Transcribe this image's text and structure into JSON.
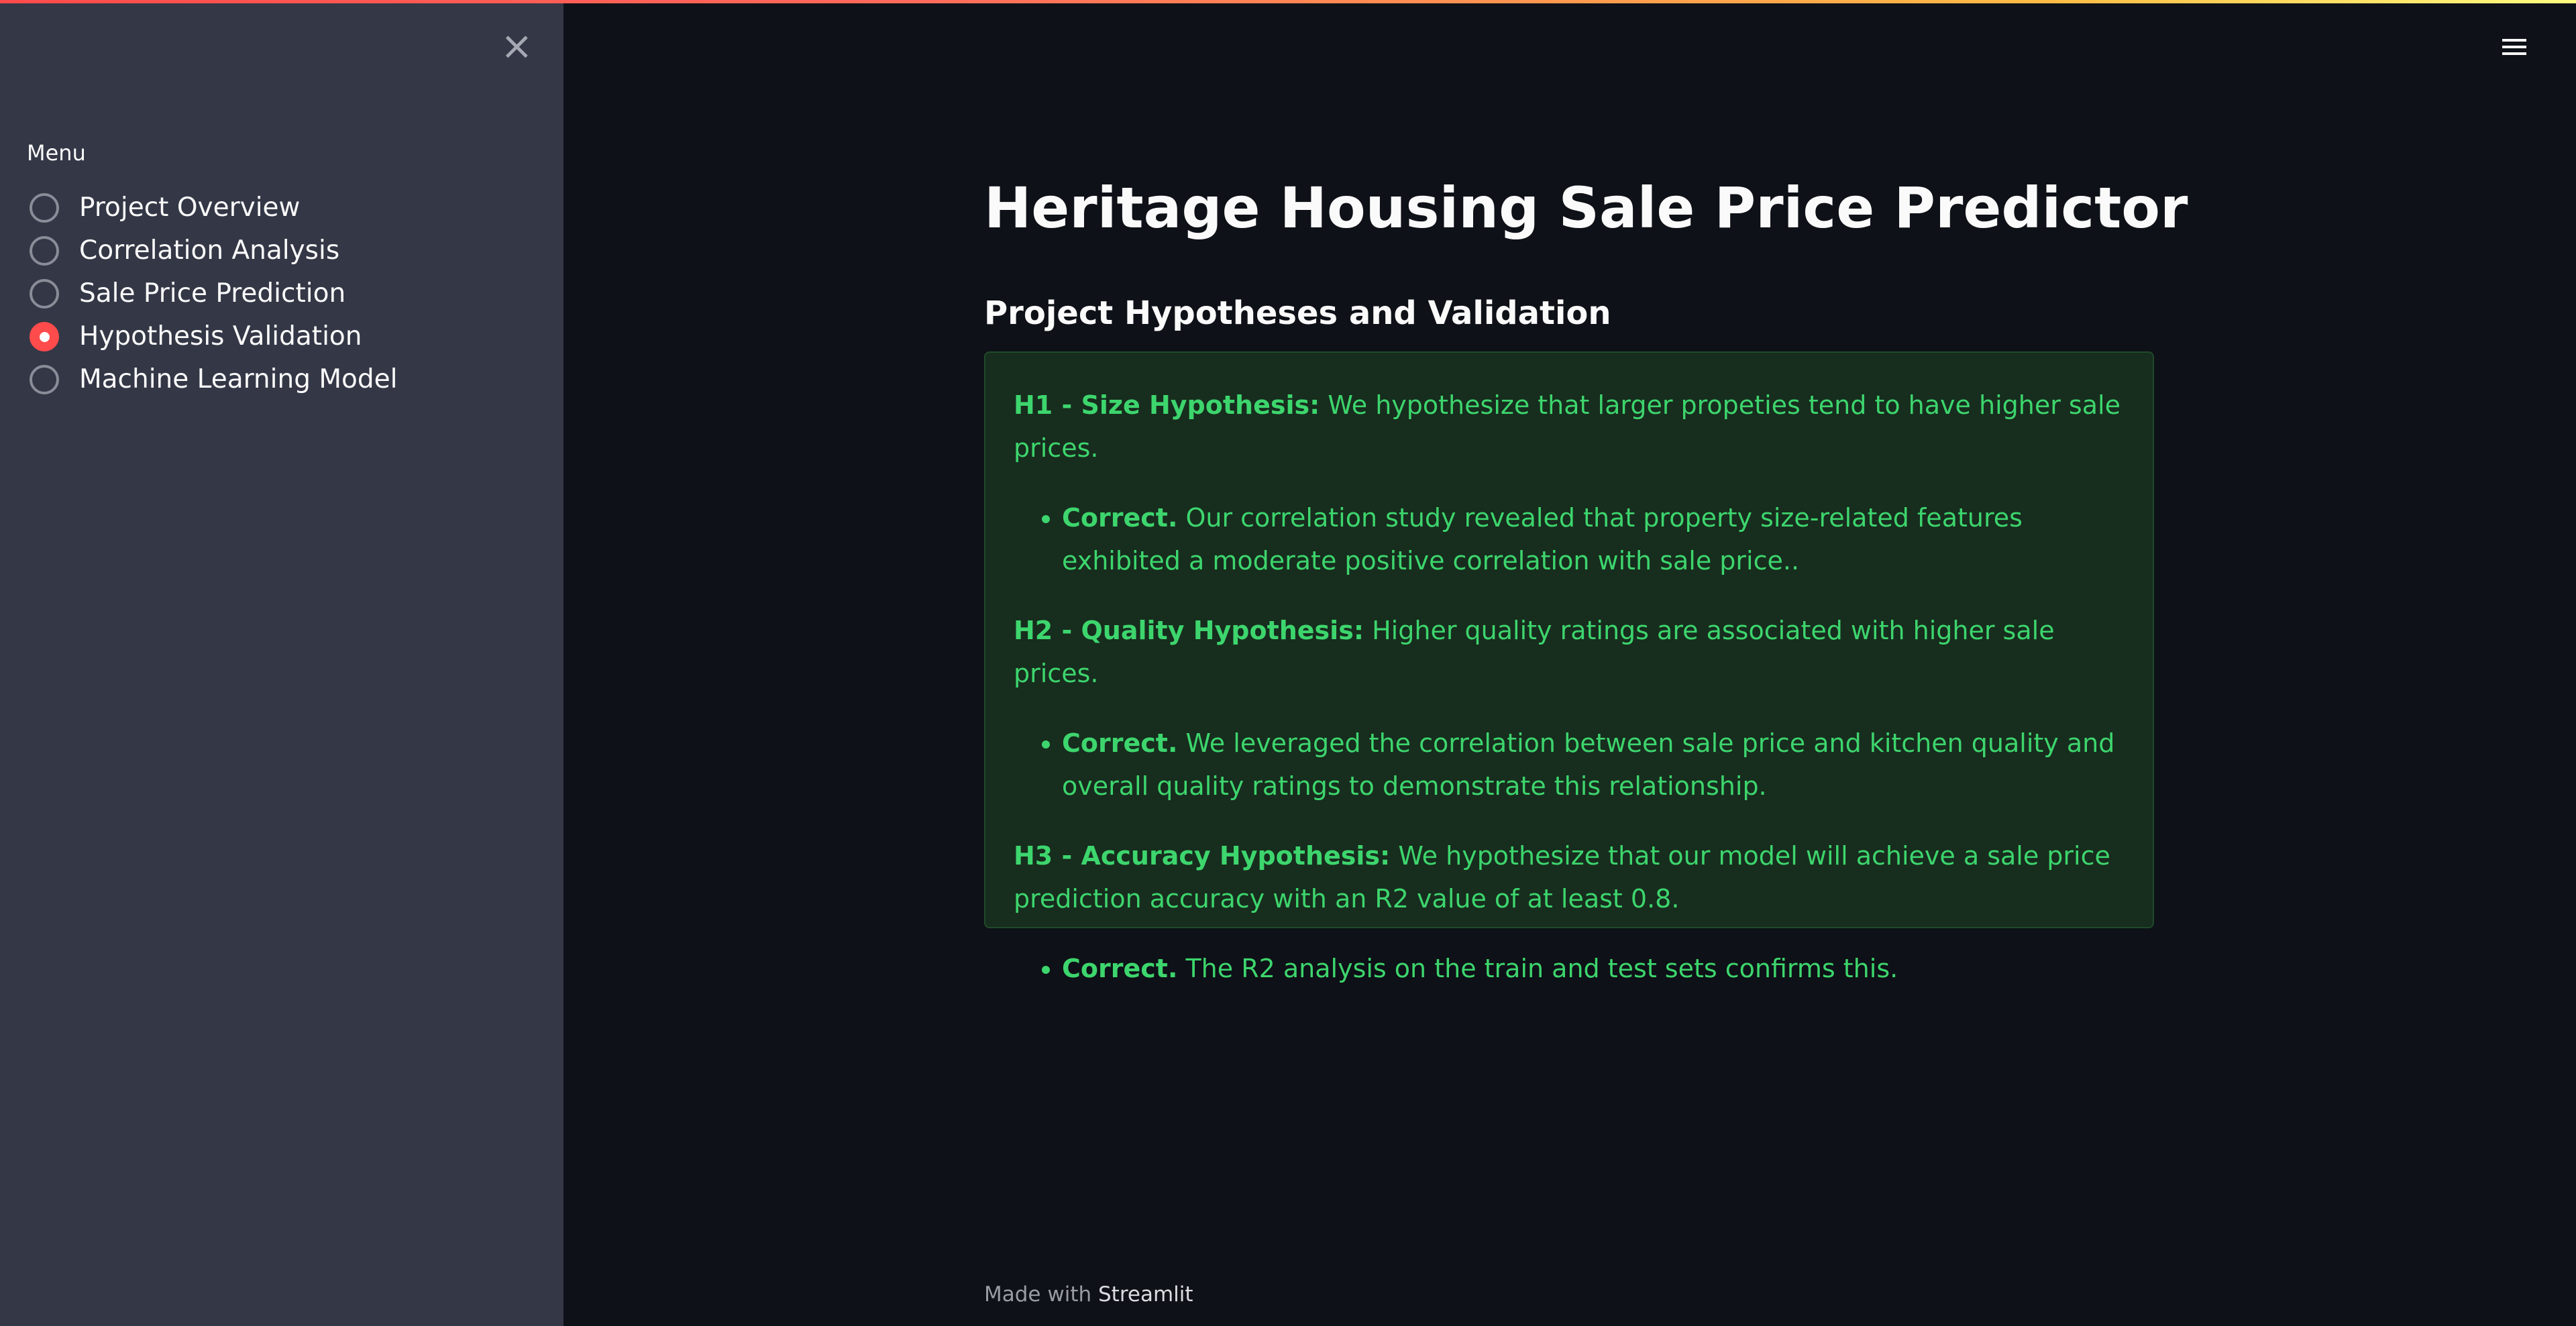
{
  "colors": {
    "accent": "#ff4b4b",
    "sidebar_bg": "#343746",
    "main_bg": "#0e1117",
    "success_text": "#3dd56d",
    "success_bg": "#172d1e"
  },
  "sidebar": {
    "close_icon": "close-x-icon",
    "menu_label": "Menu",
    "items": [
      {
        "label": "Project Overview",
        "selected": false
      },
      {
        "label": "Correlation Analysis",
        "selected": false
      },
      {
        "label": "Sale Price Prediction",
        "selected": false
      },
      {
        "label": "Hypothesis Validation",
        "selected": true
      },
      {
        "label": "Machine Learning Model",
        "selected": false
      }
    ]
  },
  "header": {
    "menu_icon": "hamburger-menu-icon"
  },
  "main": {
    "title": "Heritage Housing Sale Price Predictor",
    "subheader": "Project Hypotheses and Validation",
    "hypotheses": [
      {
        "heading": "H1 - Size Hypothesis:",
        "text": " We hypothesize that larger propeties tend to have higher sale prices.",
        "result_label": "Correct.",
        "result_text": " Our correlation study revealed that property size-related features exhibited a moderate positive correlation with sale price.."
      },
      {
        "heading": "H2 - Quality Hypothesis:",
        "text": " Higher quality ratings are associated with higher sale prices.",
        "result_label": "Correct.",
        "result_text": " We leveraged the correlation between sale price and kitchen quality and overall quality ratings to demonstrate this relationship."
      },
      {
        "heading": "H3 - Accuracy Hypothesis:",
        "text": " We hypothesize that our model will achieve a sale price prediction accuracy with an R2 value of at least 0.8.",
        "result_label": "Correct.",
        "result_text": " The R2 analysis on the train and test sets confirms this."
      }
    ]
  },
  "footer": {
    "prefix": "Made with ",
    "brand": "Streamlit"
  }
}
